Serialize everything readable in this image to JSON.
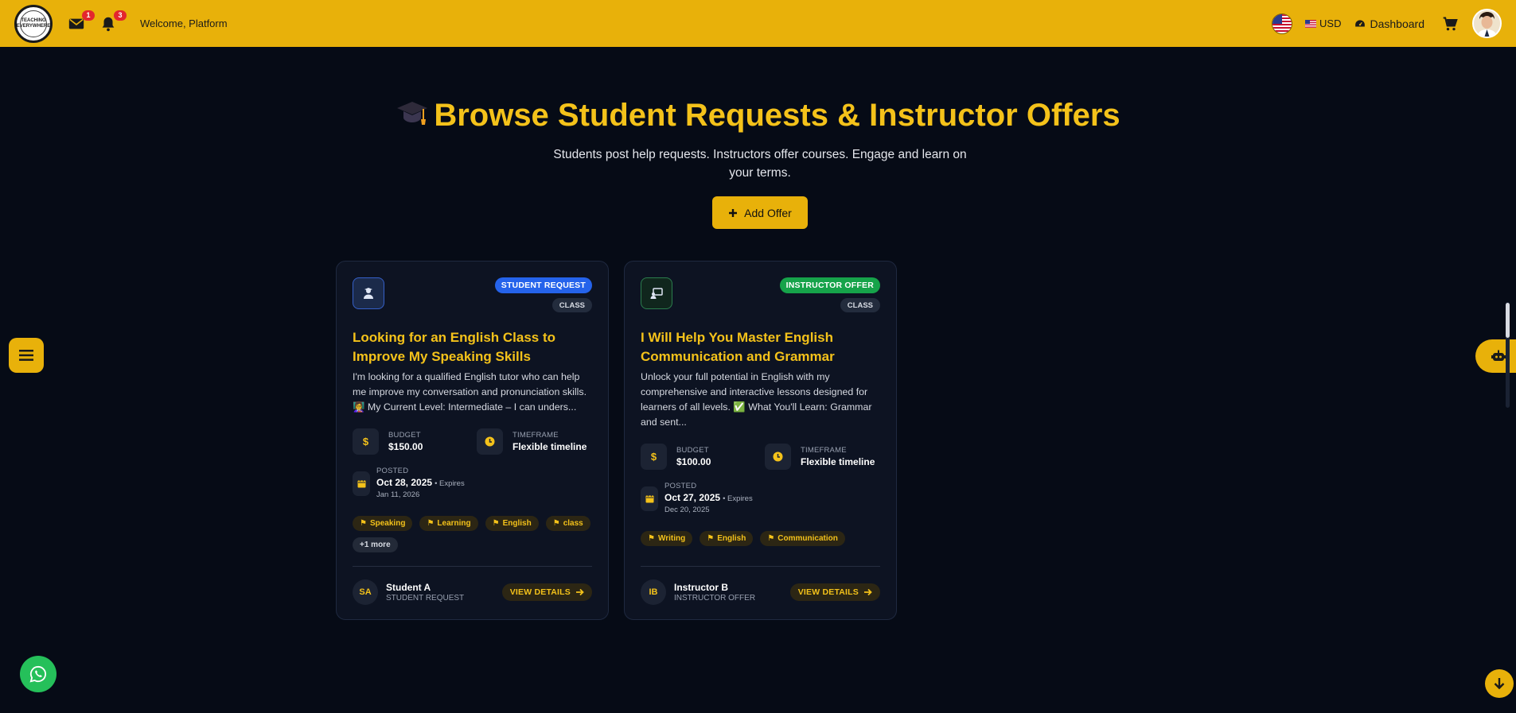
{
  "header": {
    "logo_text": "TEACHING EVERYWHERE",
    "messages_count": "1",
    "notifications_count": "3",
    "welcome": "Welcome, Platform",
    "currency": "USD",
    "dashboard": "Dashboard"
  },
  "hero": {
    "title": "Browse Student Requests & Instructor Offers",
    "subtitle": "Students post help requests. Instructors offer courses. Engage and learn on your terms.",
    "add_offer": "Add Offer"
  },
  "cards": [
    {
      "badge": "STUDENT REQUEST",
      "badge_color": "#2563eb",
      "category": "CLASS",
      "title": "Looking for an English Class to Improve My Speaking Skills",
      "description": "I'm looking for a qualified English tutor who can help me improve my conversation and pronunciation skills. 👩‍🏫 My Current Level: Intermediate – I can unders...",
      "budget_label": "BUDGET",
      "budget": "$150.00",
      "timeframe_label": "TIMEFRAME",
      "timeframe": "Flexible timeline",
      "posted_label": "POSTED",
      "posted": "Oct 28, 2025",
      "expires_label": "• Expires",
      "expires": "Jan 11, 2026",
      "tags": [
        "Speaking",
        "Learning",
        "English",
        "class"
      ],
      "more_tags": "+1 more",
      "author_initials": "SA",
      "author_name": "Student A",
      "author_role": "STUDENT REQUEST",
      "cta": "VIEW DETAILS"
    },
    {
      "badge": "INSTRUCTOR OFFER",
      "badge_color": "#16a34a",
      "category": "CLASS",
      "title": "I Will Help You Master English Communication and Grammar",
      "description": "Unlock your full potential in English with my comprehensive and interactive lessons designed for learners of all levels. ✅ What You'll Learn: Grammar and sent...",
      "budget_label": "BUDGET",
      "budget": "$100.00",
      "timeframe_label": "TIMEFRAME",
      "timeframe": "Flexible timeline",
      "posted_label": "POSTED",
      "posted": "Oct 27, 2025",
      "expires_label": "• Expires",
      "expires": "Dec 20, 2025",
      "tags": [
        "Writing",
        "English",
        "Communication"
      ],
      "author_initials": "IB",
      "author_name": "Instructor B",
      "author_role": "INSTRUCTOR OFFER",
      "cta": "VIEW DETAILS"
    }
  ],
  "colors": {
    "accent": "#e8b10a",
    "title_gold": "#f4c21a",
    "background": "#060b16",
    "card_bg": "#0d1322",
    "whatsapp": "#25c05a"
  },
  "icons": {
    "hero": "graduation-cap-icon",
    "menu": "hamburger-icon",
    "bot": "robot-icon",
    "whatsapp": "whatsapp-icon",
    "scroll": "arrow-down-icon"
  }
}
